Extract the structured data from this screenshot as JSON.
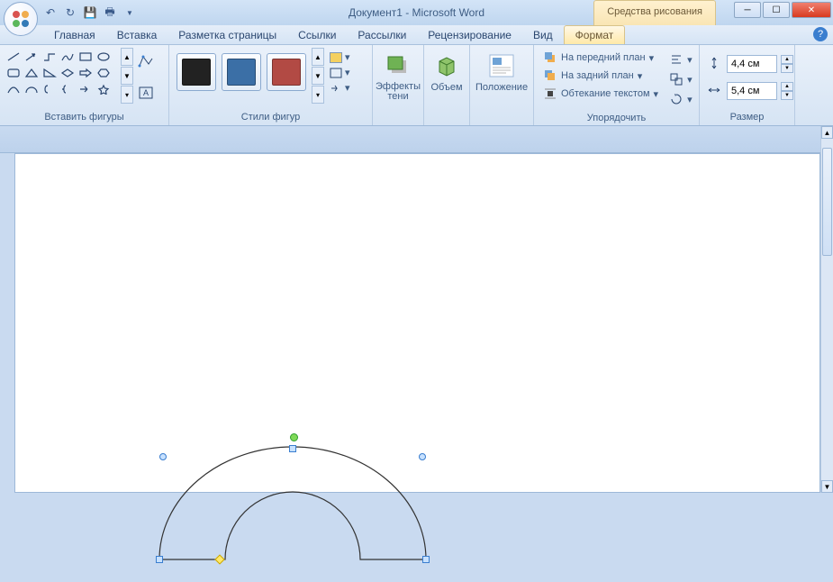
{
  "title": "Документ1 - Microsoft Word",
  "context_tab": "Средства рисования",
  "tabs": {
    "home": "Главная",
    "insert": "Вставка",
    "page_layout": "Разметка страницы",
    "references": "Ссылки",
    "mailings": "Рассылки",
    "review": "Рецензирование",
    "view": "Вид",
    "format": "Формат"
  },
  "groups": {
    "insert_shapes": "Вставить фигуры",
    "shape_styles": "Стили фигур",
    "shadow": "Эффекты тени",
    "volume": "Объем",
    "position": "Положение",
    "arrange": "Упорядочить",
    "size": "Размер"
  },
  "shadow_btn": "Эффекты\nтени",
  "volume_btn": "Объем",
  "position_btn": "Положение",
  "arrange": {
    "bring_front": "На передний план",
    "send_back": "На задний план",
    "text_wrap": "Обтекание текстом"
  },
  "size": {
    "height": "4,4 см",
    "width": "5,4 см"
  },
  "style_colors": [
    "#222222",
    "#3b6fa6",
    "#b24a44"
  ]
}
